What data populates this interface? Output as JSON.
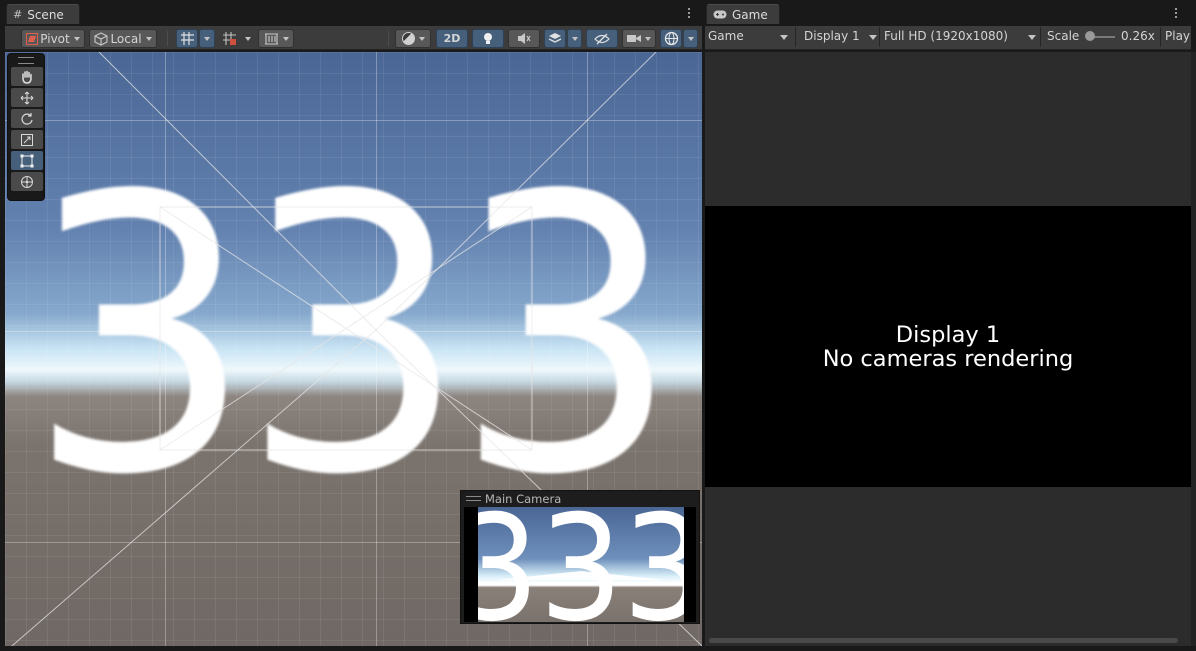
{
  "scene_panel": {
    "tab_label": "Scene",
    "toolbar": {
      "pivot_label": "Pivot",
      "local_label": "Local",
      "mode_2d_label": "2D"
    },
    "scene_text": "333",
    "camera_preview": {
      "title": "Main Camera",
      "text": "333"
    }
  },
  "game_panel": {
    "tab_label": "Game",
    "toolbar": {
      "view_mode": "Game",
      "display": "Display 1",
      "resolution": "Full HD (1920x1080)",
      "scale_label": "Scale",
      "scale_value": "0.26x",
      "scale_fraction": 0.0,
      "play_label": "Play"
    },
    "message_line1": "Display 1",
    "message_line2": "No cameras rendering"
  },
  "colors": {
    "panel": "#3c3c3c",
    "toolbar_active": "#46607c",
    "game_bg": "#2c2c2c"
  }
}
